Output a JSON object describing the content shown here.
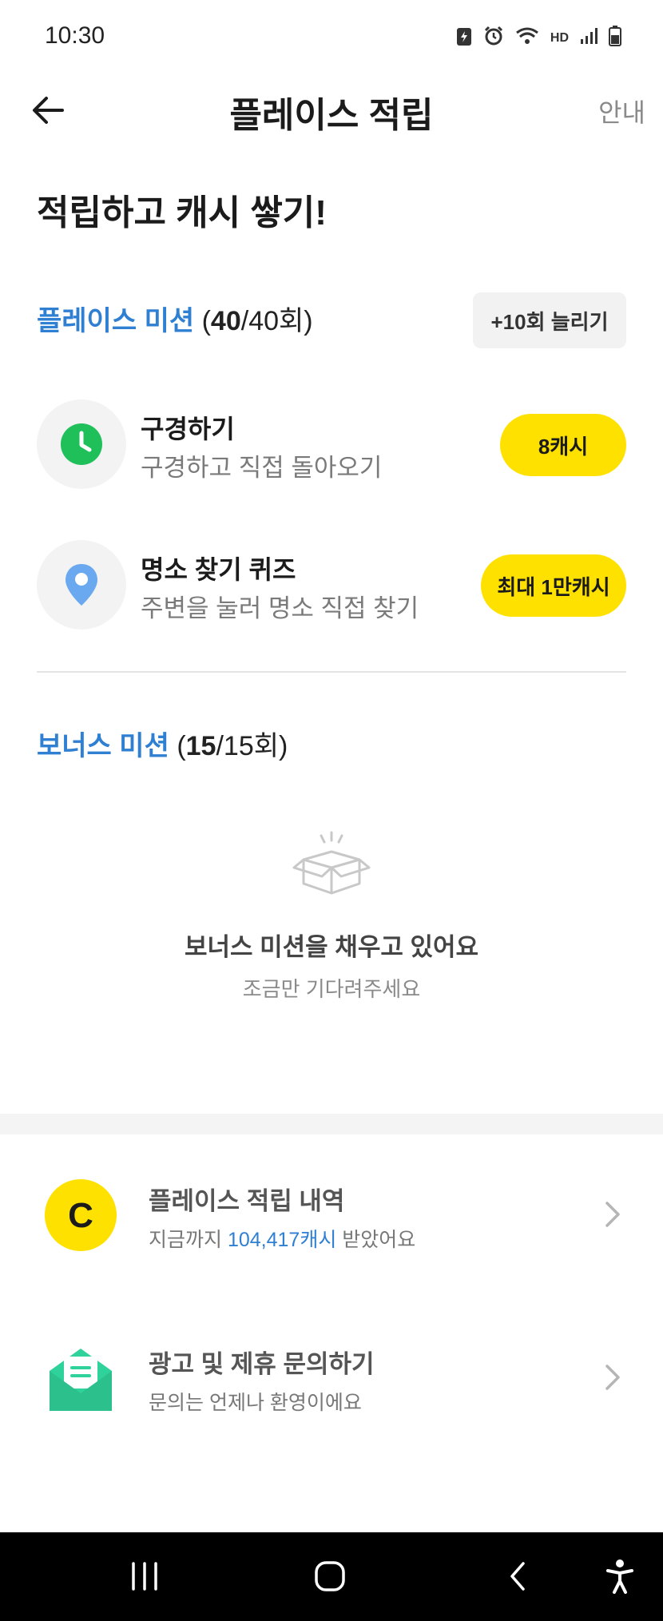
{
  "status": {
    "time": "10:30",
    "icons": [
      "battery-saver-icon",
      "alarm-icon",
      "wifi-icon",
      "hd-voice-icon",
      "signal-icon",
      "battery-icon"
    ],
    "hd_voice": "HD"
  },
  "header": {
    "title": "플레이스 적립",
    "guide_label": "안내"
  },
  "hero": {
    "title": "적립하고 캐시 쌓기!"
  },
  "place_mission": {
    "label": "플레이스 미션",
    "count_open": "(",
    "count_done": "40",
    "count_total": "/40회)",
    "more_button": "+10회 늘리기",
    "items": [
      {
        "title": "구경하기",
        "subtitle": "구경하고 직접 돌아오기",
        "reward": "8캐시",
        "icon": "clock-icon"
      },
      {
        "title": "명소 찾기 퀴즈",
        "subtitle": "주변을 눌러 명소 직접 찾기",
        "reward": "최대 1만캐시",
        "icon": "location-pin-icon"
      }
    ]
  },
  "bonus_mission": {
    "label": "보너스 미션",
    "count_open": "(",
    "count_done": "15",
    "count_total": "/15회)",
    "empty_title": "보너스 미션을 채우고 있어요",
    "empty_subtitle": "조금만 기다려주세요"
  },
  "links": [
    {
      "title": "플레이스 적립 내역",
      "sub_prefix": "지금까지 ",
      "sub_highlight": "104,417캐시",
      "sub_suffix": " 받았어요",
      "icon": "cash-coin-icon",
      "coin_letter": "C"
    },
    {
      "title": "광고 및 제휴 문의하기",
      "subtitle": "문의는 언제나 환영이에요",
      "icon": "mail-icon"
    }
  ],
  "colors": {
    "accent_blue": "#2f7fd3",
    "cash_yellow": "#ffe100",
    "clock_green": "#1fc05a",
    "pin_blue": "#6aa9f0",
    "mail_green": "#2fd29a"
  }
}
